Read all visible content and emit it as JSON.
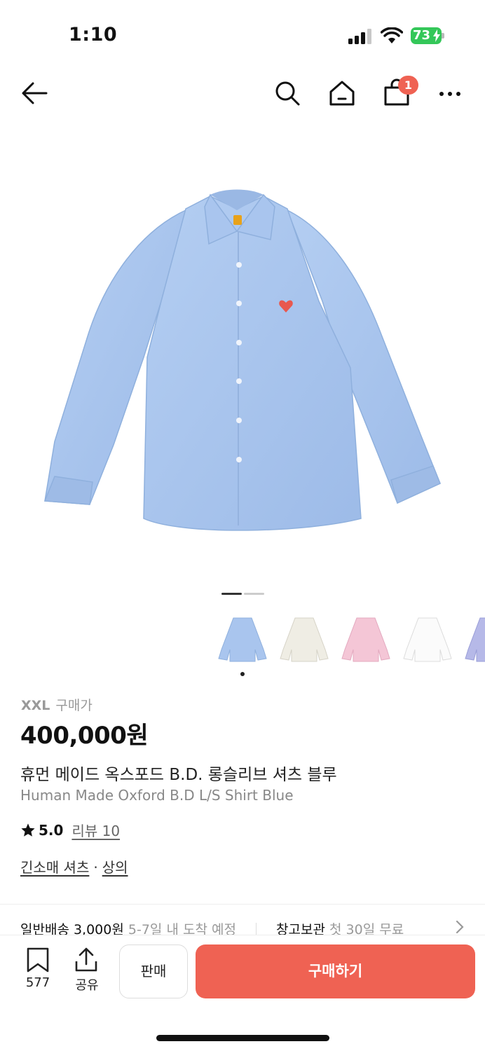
{
  "status_bar": {
    "time": "1:10",
    "battery": "73"
  },
  "nav": {
    "cart_count": "1"
  },
  "product": {
    "size": "XXL",
    "price_label": "구매가",
    "price": "400,000원",
    "name_ko": "휴먼 메이드 옥스포드 B.D. 롱슬리브 셔츠 블루",
    "name_en": "Human Made Oxford B.D L/S Shirt Blue",
    "rating": "5.0",
    "review_label": "리뷰 10",
    "category_1": "긴소매 셔츠",
    "category_sep": "·",
    "category_2": "상의"
  },
  "thumbnails": [
    {
      "color": "#a9c5ee"
    },
    {
      "color": "#efede4"
    },
    {
      "color": "#f4c6d6"
    },
    {
      "color": "#f8f8f8"
    },
    {
      "color": "#b6b9e8"
    }
  ],
  "shipping": {
    "label": "일반배송",
    "price": "3,000원",
    "eta": "5-7일 내 도착 예정",
    "storage_label": "창고보관",
    "storage_desc": "첫 30일 무료"
  },
  "bottom": {
    "bookmark_count": "577",
    "share_label": "공유",
    "sell_label": "판매",
    "buy_label": "구매하기"
  },
  "colors": {
    "accent": "#ef6253",
    "shirt": "#a9c5ee"
  }
}
